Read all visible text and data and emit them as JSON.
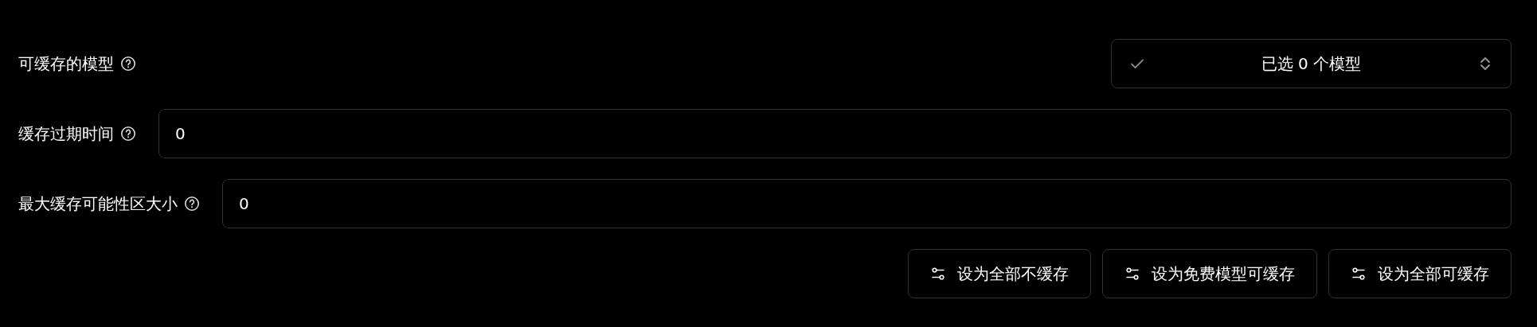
{
  "model_select": {
    "label": "可缓存的模型",
    "value": "已选 0 个模型"
  },
  "fields": [
    {
      "label": "缓存过期时间",
      "value": "0"
    },
    {
      "label": "最大缓存可能性区大小",
      "value": "0"
    }
  ],
  "buttons": [
    {
      "label": "设为全部不缓存"
    },
    {
      "label": "设为免费模型可缓存"
    },
    {
      "label": "设为全部可缓存"
    }
  ]
}
